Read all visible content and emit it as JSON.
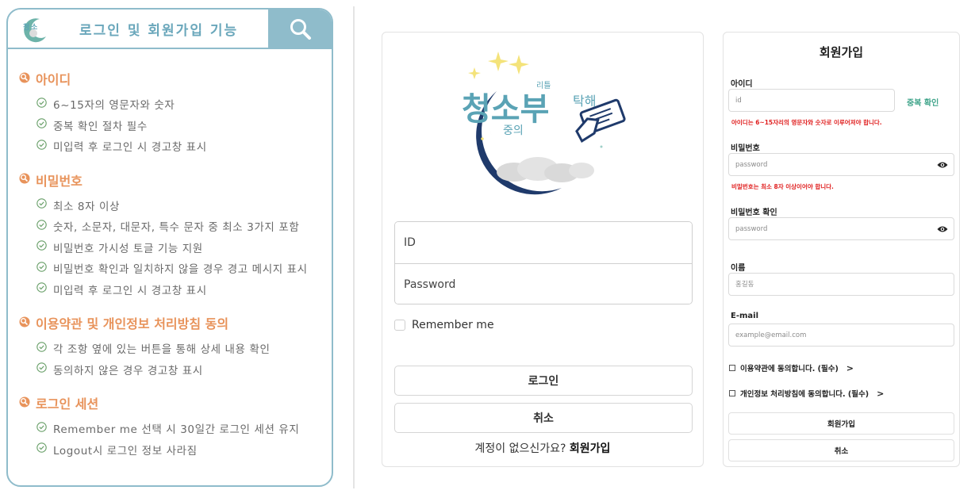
{
  "panel": {
    "title": "로그인 및 회원가입 기능",
    "logo_text": "청소부",
    "sections": [
      {
        "title": "아이디",
        "items": [
          "6~15자의 영문자와 숫자",
          "중복 확인 절차 필수",
          "미입력 후 로그인 시 경고창 표시"
        ]
      },
      {
        "title": "비밀번호",
        "items": [
          "최소 8자 이상",
          "숫자, 소문자, 대문자, 특수 문자 중 최소 3가지 포함",
          "비밀번호 가시성 토글 기능 지원",
          "비밀번호 확인과 일치하지 않을 경우 경고 메시지 표시",
          "미입력 후 로그인 시 경고창 표시"
        ]
      },
      {
        "title": "이용약관 및 개인정보 처리방침 동의",
        "items": [
          "각 조항 옆에 있는 버튼을 통해 상세 내용 확인",
          "동의하지 않은 경우 경고창 표시"
        ]
      },
      {
        "title": "로그인 세션",
        "items": [
          "Remember me 선택 시 30일간 로그인 세션 유지",
          "Logout시 로그인 정보 사라짐"
        ]
      }
    ]
  },
  "login": {
    "logo": {
      "main": "청소부",
      "small_top": "리틀",
      "small_mid": "중의",
      "small_right": "탁해"
    },
    "id_placeholder": "ID",
    "password_placeholder": "Password",
    "remember_label": "Remember me",
    "login_button": "로그인",
    "cancel_button": "취소",
    "signup_prompt": "계정이 없으신가요?",
    "signup_link": "회원가입"
  },
  "signup": {
    "title": "회원가입",
    "id_label": "아이디",
    "id_placeholder": "id",
    "dup_check": "중복 확인",
    "id_error": "아이디는 6~15자리의 영문자와 숫자로 이루어져야 합니다.",
    "password_label": "비밀번호",
    "password_placeholder": "password",
    "password_error": "비밀번호는 최소 8자 이상이어야 합니다.",
    "password_confirm_label": "비밀번호 확인",
    "password_confirm_placeholder": "password",
    "name_label": "이름",
    "name_placeholder": "홍길동",
    "email_label": "E-mail",
    "email_placeholder": "example@email.com",
    "terms_label": "이용약관에 동의합니다. (필수)",
    "privacy_label": "개인정보 처리방침에 동의합니다. (필수)",
    "chevron": ">",
    "signup_button": "회원가입",
    "cancel_button": "취소"
  }
}
